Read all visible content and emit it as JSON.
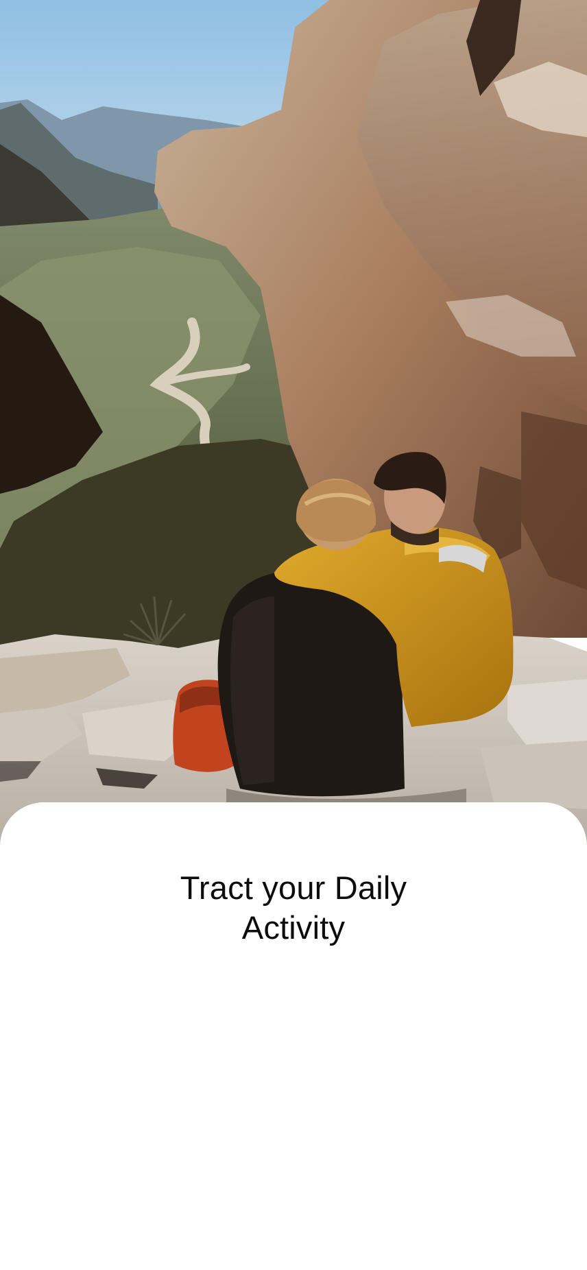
{
  "onboarding": {
    "hero_image": {
      "icon": "hero-photo",
      "alt": ""
    },
    "headline_line_1": "Tract your Daily",
    "headline_line_2": "Activity"
  },
  "colors": {
    "sky": "#a9cde8",
    "rock": "#b08a6c",
    "jacket_yellow": "#c8921c",
    "sheet_background": "#ffffff",
    "text": "#0c0c0c"
  }
}
